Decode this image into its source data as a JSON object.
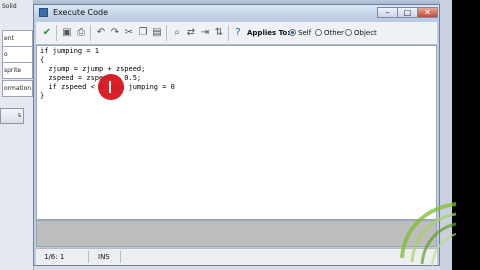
{
  "background_app": {
    "solid_label": "Solid",
    "panel_labels": [
      "ent",
      "o",
      "sprite",
      "ormation"
    ],
    "button_label": "s"
  },
  "window": {
    "title": "Execute Code",
    "controls": {
      "minimize": "–",
      "maximize": "□",
      "close": "✕"
    }
  },
  "toolbar": {
    "icons": [
      "check-icon",
      "save-icon",
      "print-icon",
      "undo-icon",
      "redo-icon",
      "cut-icon",
      "copy-icon",
      "paste-icon",
      "find-icon",
      "replace-icon",
      "find-next-icon",
      "goto-icon",
      "indent-icon",
      "help-icon"
    ],
    "applies_to_label": "Applies To:",
    "options": [
      {
        "label": "Self",
        "selected": true
      },
      {
        "label": "Other",
        "selected": false
      },
      {
        "label": "Object",
        "selected": false
      }
    ]
  },
  "editor": {
    "lines": [
      "if jumping = 1",
      "{",
      "  zjump = zjump + zspeed;",
      "  zspeed = zspeed - 0.5;",
      "  if zspeed < 0 then jumping = 0",
      "}"
    ]
  },
  "status": {
    "position": "1/6: 1",
    "mode": "INS"
  },
  "colors": {
    "accent": "#1d5db0",
    "cursor_marker": "#d8141c",
    "watermark": "#7fbf2e"
  }
}
